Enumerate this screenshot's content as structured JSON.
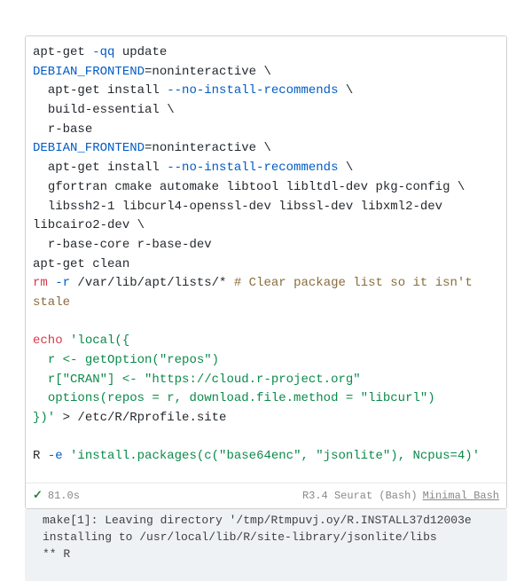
{
  "code": {
    "line1": {
      "a": "apt-get ",
      "flag": "-qq",
      "b": " update"
    },
    "line2": {
      "env": "DEBIAN_FRONTEND",
      "rest": "=noninteractive \\"
    },
    "line3": {
      "a": "  apt-get install ",
      "flag": "--no-install-recommends",
      "b": " \\"
    },
    "line4": "  build-essential \\",
    "line5": "  r-base",
    "line6": {
      "env": "DEBIAN_FRONTEND",
      "rest": "=noninteractive \\"
    },
    "line7": {
      "a": "  apt-get install ",
      "flag": "--no-install-recommends",
      "b": " \\"
    },
    "line8": "  gfortran cmake automake libtool libltdl-dev pkg-config \\",
    "line9": "  libssh2-1 libcurl4-openssl-dev libssl-dev libxml2-dev libcairo2-dev \\",
    "line10": "  r-base-core r-base-dev",
    "line11": "apt-get clean",
    "line12": {
      "rm": "rm ",
      "flag": "-r",
      "path": " /var/lib/apt/lists/* ",
      "comment": "# Clear package list so it isn't stale"
    },
    "blank1": "",
    "line13": {
      "echo": "echo ",
      "str": "'local({"
    },
    "line14": "  r <- getOption(\"repos\")",
    "line15": "  r[\"CRAN\"] <- \"https://cloud.r-project.org\"",
    "line16": "  options(repos = r, download.file.method = \"libcurl\")",
    "line17": {
      "str": "})'",
      "rest": " > /etc/R/Rprofile.site"
    },
    "blank2": "",
    "line18": {
      "a": "R ",
      "flag": "-e",
      "b": " ",
      "str": "'install.packages(c(\"base64enc\", \"jsonlite\"), Ncpus=4)'"
    }
  },
  "status": {
    "time": "81.0s",
    "kernel_desc": "R3.4 Seurat (Bash)",
    "kernel_link": "Minimal Bash"
  },
  "output": {
    "line1": "make[1]: Leaving directory '/tmp/Rtmpuvj.oy/R.INSTALL37d12003e",
    "line2": "installing to /usr/local/lib/R/site-library/jsonlite/libs",
    "line3": "** R"
  }
}
